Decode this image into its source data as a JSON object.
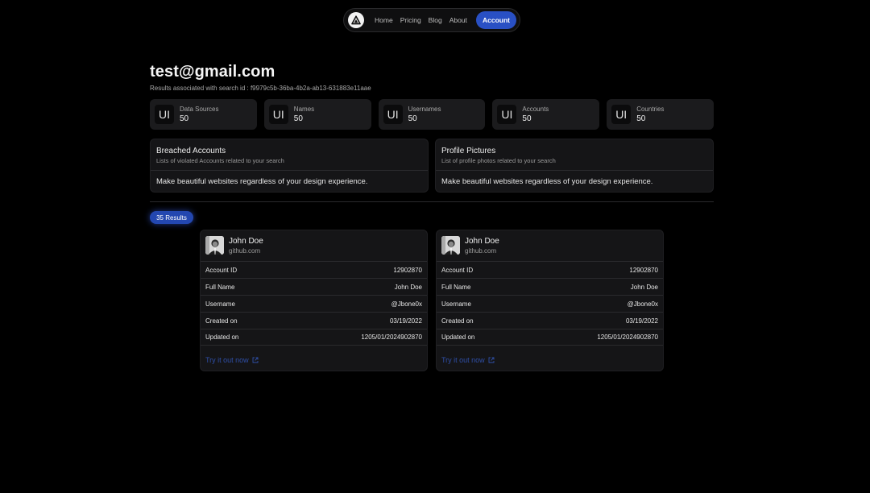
{
  "nav": {
    "logo_icon": "triangle-logo-icon",
    "links": [
      "Home",
      "Pricing",
      "Blog",
      "About"
    ],
    "account_label": "Account",
    "accent": "#2950c4"
  },
  "header": {
    "title": "test@gmail.com",
    "subtitle": "Results associated with search id : f9979c5b-36ba-4b2a-ab13-631883e11aae"
  },
  "stats": [
    {
      "icon": "UI",
      "label": "Data Sources",
      "value": "50"
    },
    {
      "icon": "UI",
      "label": "Names",
      "value": "50"
    },
    {
      "icon": "UI",
      "label": "Usernames",
      "value": "50"
    },
    {
      "icon": "UI",
      "label": "Accounts",
      "value": "50"
    },
    {
      "icon": "UI",
      "label": "Countries",
      "value": "50"
    }
  ],
  "panels": [
    {
      "title": "Breached Accounts",
      "subtitle": "Lists of violated Accounts related to your search",
      "body": "Make beautiful websites regardless of your design experience."
    },
    {
      "title": "Profile Pictures",
      "subtitle": "List of profile photos related to your search",
      "body": "Make beautiful websites regardless of your design experience."
    }
  ],
  "results_badge": "35 Results",
  "cards": [
    {
      "name": "John Doe",
      "site": "github.com",
      "rows": [
        {
          "label": "Account ID",
          "value": "12902870"
        },
        {
          "label": "Full Name",
          "value": "John Doe"
        },
        {
          "label": "Username",
          "value": "@Jbone0x"
        },
        {
          "label": "Created on",
          "value": "03/19/2022"
        },
        {
          "label": "Updated on",
          "value": "1205/01/2024902870"
        }
      ],
      "link": "Try it out now"
    },
    {
      "name": "John Doe",
      "site": "github.com",
      "rows": [
        {
          "label": "Account ID",
          "value": "12902870"
        },
        {
          "label": "Full Name",
          "value": "John Doe"
        },
        {
          "label": "Username",
          "value": "@Jbone0x"
        },
        {
          "label": "Created on",
          "value": "03/19/2022"
        },
        {
          "label": "Updated on",
          "value": "1205/01/2024902870"
        }
      ],
      "link": "Try it out now"
    }
  ]
}
